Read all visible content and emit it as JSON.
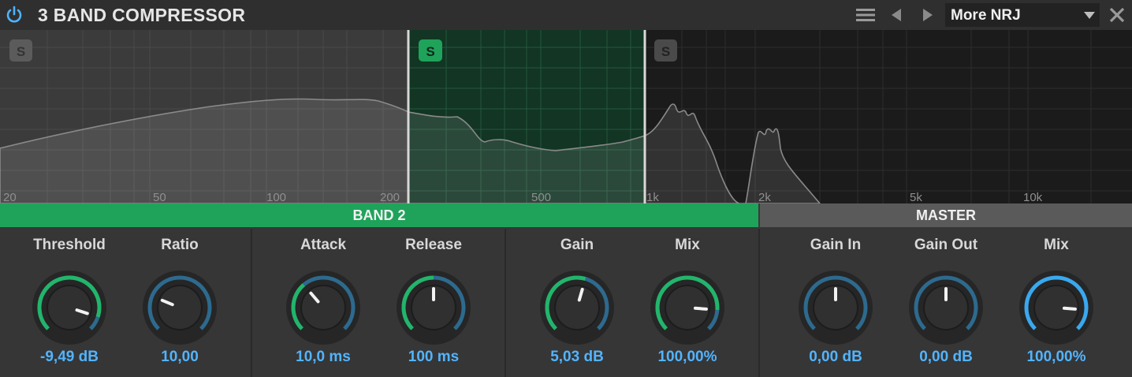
{
  "app": {
    "title": "3 BAND COMPRESSOR",
    "preset": "More NRJ",
    "icons": [
      "power-icon",
      "menu-icon",
      "prev-icon",
      "next-icon",
      "dropdown-arrow-icon",
      "close-icon"
    ]
  },
  "colors": {
    "accent_green": "#1fa35a",
    "value_blue": "#52b4ff",
    "ring_green": "#22b56b",
    "ring_blue": "#2d6a8e",
    "ring_cyan": "#3aa8ee"
  },
  "spectrum": {
    "freq_labels": [
      "20",
      "50",
      "100",
      "200",
      "500",
      "1k",
      "2k",
      "5k",
      "10k"
    ],
    "solo_labels": [
      "S",
      "S",
      "S"
    ],
    "active_band": 2
  },
  "band_header": "BAND 2",
  "master_header": "MASTER",
  "knobs": {
    "threshold": {
      "label": "Threshold",
      "value": "-9,49 dB",
      "fill": 0.9,
      "ring": "green"
    },
    "ratio": {
      "label": "Ratio",
      "value": "10,00",
      "fill": 0.25,
      "ring": "blue"
    },
    "attack": {
      "label": "Attack",
      "value": "10,0 ms",
      "fill": 0.35,
      "ring": "mixed"
    },
    "release": {
      "label": "Release",
      "value": "100 ms",
      "fill": 0.5,
      "ring": "mixed"
    },
    "gain": {
      "label": "Gain",
      "value": "5,03 dB",
      "fill": 0.56,
      "ring": "mixed"
    },
    "band_mix": {
      "label": "Mix",
      "value": "100,00%",
      "fill": 0.85,
      "ring": "green"
    },
    "gain_in": {
      "label": "Gain In",
      "value": "0,00 dB",
      "fill": 0.5,
      "ring": "blue"
    },
    "gain_out": {
      "label": "Gain Out",
      "value": "0,00 dB",
      "fill": 0.5,
      "ring": "blue"
    },
    "master_mix": {
      "label": "Mix",
      "value": "100,00%",
      "fill": 0.85,
      "ring": "cyan"
    }
  }
}
